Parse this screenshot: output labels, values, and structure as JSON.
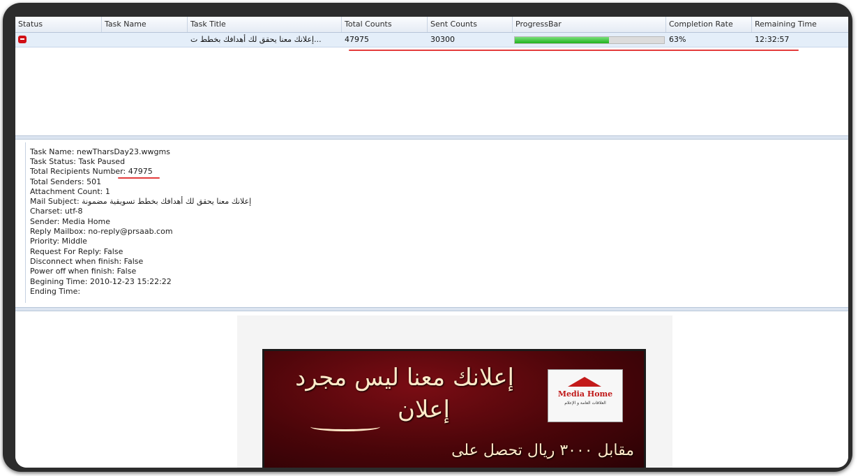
{
  "grid": {
    "columns": [
      "Status",
      "Task Name",
      "Task Title",
      "Total Counts",
      "Sent Counts",
      "ProgressBar",
      "Completion Rate",
      "Remaining Time"
    ],
    "rows": [
      {
        "status_icon": "stop-icon",
        "task_name": "",
        "task_title": "...إعلانك معنا يحقق لك أهدافك بخطط ت",
        "total_counts": "47975",
        "sent_counts": "30300",
        "progress": 0.63,
        "completion_rate": "63%",
        "remaining_time": "12:32:57"
      }
    ]
  },
  "details": {
    "task_name": "Task Name:  newTharsDay23.wwgms",
    "task_status": "Task Status:  Task Paused",
    "total_recipients": "Total Recipients Number:  47975",
    "total_senders": "Total Senders:  501",
    "attachment_count": "Attachment Count:  1",
    "mail_subject": "Mail Subject:  إعلانك معنا يحقق لك أهدافك بخطط تسويقية مضمونة",
    "charset": "Charset:  utf-8",
    "sender": "Sender:  Media Home",
    "reply_mailbox": "Reply Mailbox:  no-reply@prsaab.com",
    "priority": "Priority:  Middle",
    "request_reply": "Request For Reply:  False",
    "disconnect": "Disconnect when finish:  False",
    "power_off": "Power off when finish:  False",
    "begin_time": "Begining Time:  2010-12-23 15:22:22",
    "end_time": "Ending Time:"
  },
  "preview": {
    "headline_1": "إعلانك معنا ليس مجرد",
    "headline_2": "إعلان",
    "offer_line": "مقابل ٣٠٠٠ ريال تحصل على",
    "logo_title": "Media Home",
    "logo_sub": "العلاقات العامة و الإعلام"
  },
  "colors": {
    "frame": "#2c2c2c",
    "progress_fill": "#1fb31f",
    "annotation_red": "#e33b3b",
    "status_stop": "#d10f16"
  }
}
